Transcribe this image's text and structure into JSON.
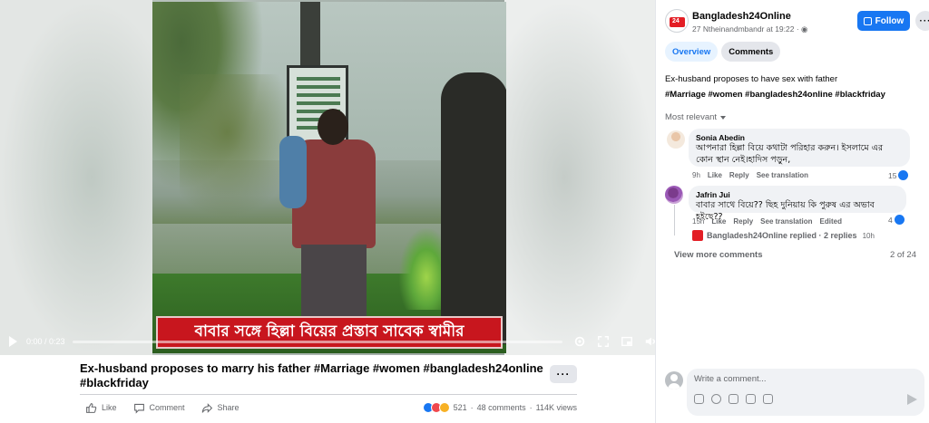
{
  "video": {
    "caption": "বাবার সঙ্গে হিল্লা বিয়ের প্রস্তাব সাবেক স্বামীর",
    "time": "0:00 / 0:23",
    "progress": 0
  },
  "post": {
    "title": "Ex-husband proposes to marry his father #Marriage #women #bangladesh24online #blackfriday",
    "more_label": "···",
    "actions": {
      "like": "Like",
      "comment": "Comment",
      "share": "Share"
    },
    "reaction_count": "521",
    "comments_count": "48 comments",
    "views": "114K views"
  },
  "page": {
    "name": "Bangladesh24Online",
    "meta": "27 Ntheinandmbandr at 19:22 · ",
    "follow_label": "Follow",
    "more_label": "···"
  },
  "tabs": [
    {
      "label": "Overview",
      "active": true
    },
    {
      "label": "Comments",
      "active": false
    }
  ],
  "description": {
    "line1": "Ex-husband proposes to have sex with father",
    "hashtags": "#Marriage #women #bangladesh24online #blackfriday"
  },
  "sort_label": "Most relevant",
  "comments": [
    {
      "author": "Sonia Abedin",
      "text": "আপনারা হিল্লা বিয়ে কথাটা পরিহার করুন। ইসলামে এর কোন স্থান নেই।হাদিস পড়ুন,",
      "time": "9h",
      "like": "Like",
      "reply": "Reply",
      "translate": "See translation",
      "reactions": "15"
    },
    {
      "author": "Jafrin Jui",
      "text": "বাবার সাথে বিয়ে?? ছিহ দুনিয়ায় কি পুরুষ এর অভাব হইছে??",
      "time": "15h",
      "like": "Like",
      "reply": "Reply",
      "translate": "See translation",
      "edited": "Edited",
      "reactions": "4"
    }
  ],
  "reply_summary": {
    "who": "Bangladesh24Online replied · 2 replies",
    "time": "10h"
  },
  "view_more": "View more comments",
  "comment_count": "2 of 24",
  "composer": {
    "placeholder": "Write a comment..."
  },
  "colors": {
    "accent": "#1877f2",
    "caption_red": "#c8161e"
  }
}
